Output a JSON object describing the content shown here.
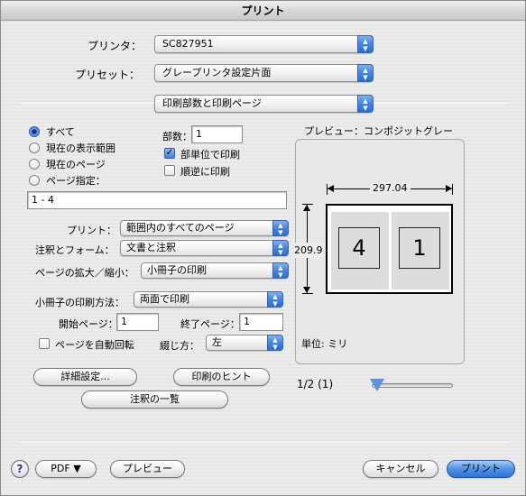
{
  "window": {
    "title": "プリント"
  },
  "printer": {
    "label": "プリンタ：",
    "value": "SC827951"
  },
  "preset": {
    "label": "プリセット：",
    "value": "グレープリンタ設定片面"
  },
  "panel": {
    "value": "印刷部数と印刷ページ"
  },
  "range": {
    "all": "すべて",
    "current_view": "現在の表示範囲",
    "current_page": "現在のページ",
    "pages": "ページ指定：",
    "pages_value": "1 - 4",
    "selected": "all"
  },
  "copies": {
    "label": "部数：",
    "value": "1",
    "collate_label": "部単位で印刷",
    "collate_checked": true,
    "reverse_label": "順逆に印刷",
    "reverse_checked": false
  },
  "print_what": {
    "label": "プリント：",
    "value": "範囲内のすべてのページ"
  },
  "comments": {
    "label": "注釈とフォーム：",
    "value": "文書と注釈"
  },
  "scaling": {
    "label": "ページの拡大／縮小：",
    "value": "小冊子の印刷"
  },
  "booklet": {
    "label": "小冊子の印刷方法：",
    "value": "両面で印刷"
  },
  "start_page": {
    "label": "開始ページ：",
    "value": "1"
  },
  "end_page": {
    "label": "終了ページ：",
    "value": "1"
  },
  "auto_rotate": {
    "label": "ページを自動回転",
    "checked": false
  },
  "binding": {
    "label": "綴じ方：",
    "value": "左"
  },
  "buttons": {
    "advanced": "詳細設定...",
    "hints": "印刷のヒント",
    "summarize": "注釈の一覧",
    "pdf": "PDF ▼",
    "preview": "プレビュー",
    "cancel": "キャンセル",
    "print": "プリント",
    "help": "?"
  },
  "preview": {
    "title": "プレビュー：コンポジットグレー",
    "width": "297.04",
    "height": "209.9",
    "page_left": "4",
    "page_right": "1",
    "units": "単位: ミリ",
    "page_counter": "1/2 (1)"
  },
  "colors": {
    "accent": "#3f84e0"
  },
  "icons": {
    "popup_arrows": "up-down-arrows-icon"
  }
}
